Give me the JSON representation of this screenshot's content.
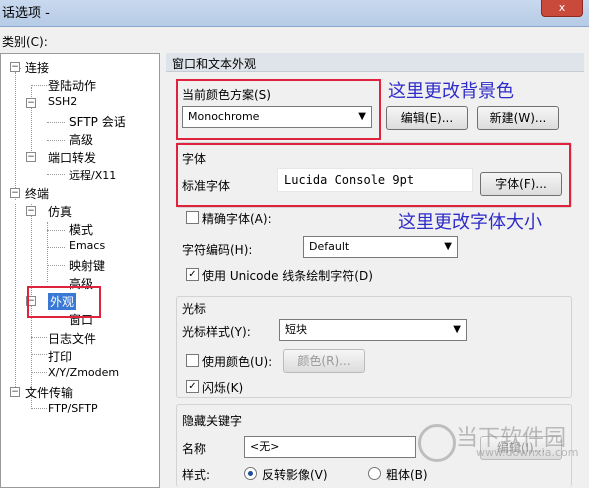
{
  "window": {
    "title": "话选项 -",
    "close_label": "x"
  },
  "category_label": "类别(C):",
  "tree": {
    "connect": "连接",
    "login_actions": "登陆动作",
    "ssh2": "SSH2",
    "sftp_session": "SFTP 会话",
    "advanced": "高级",
    "port_forward": "端口转发",
    "remote_x11": "远程/X11",
    "terminal": "终端",
    "emulation": "仿真",
    "modes": "模式",
    "emacs": "Emacs",
    "mapped_keys": "映射键",
    "advanced2": "高级",
    "appearance": "外观",
    "window": "窗口",
    "log_file": "日志文件",
    "print": "打印",
    "xyzmodem": "X/Y/Zmodem",
    "file_transfer": "文件传输",
    "ftp_sftp": "FTP/SFTP"
  },
  "panel": {
    "header": "窗口和文本外观",
    "scheme_label": "当前颜色方案(S)",
    "scheme_value": "Monochrome",
    "edit_button": "编辑(E)...",
    "new_button": "新建(W)...",
    "font_group": "字体",
    "standard_font_label": "标准字体",
    "standard_font_value": "Lucida Console 9pt",
    "font_button": "字体(F)...",
    "precise_font": "精确字体(A):",
    "encoding_label": "字符编码(H):",
    "encoding_value": "Default",
    "unicode_line": "使用 Unicode 线条绘制字符(D)",
    "cursor_group": "光标",
    "cursor_style_label": "光标样式(Y):",
    "cursor_style_value": "短块",
    "use_color": "使用颜色(U):",
    "color_button": "颜色(R)...",
    "blink": "闪烁(K)",
    "hidden_keywords": "隐藏关键字",
    "name_label": "名称",
    "name_value": "<无>",
    "edit2_button": "编辑(I)...",
    "style_label": "样式:",
    "reverse_video": "反转影像(V)",
    "bold": "粗体(B)"
  },
  "annotations": {
    "background": "这里更改背景色",
    "font_size": "这里更改字体大小",
    "color": "#2e2cc8",
    "box_color": "#e0233c"
  },
  "watermark": {
    "name": "当下软件园",
    "url": "www.downxia.com"
  }
}
